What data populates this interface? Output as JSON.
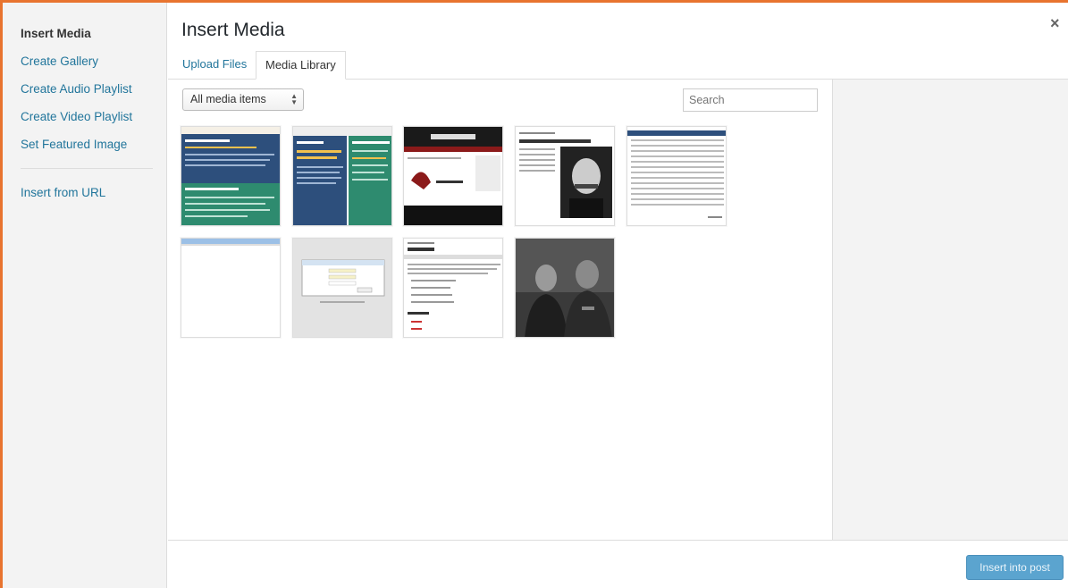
{
  "sidebar": {
    "items": [
      {
        "label": "Insert Media",
        "active": true
      },
      {
        "label": "Create Gallery"
      },
      {
        "label": "Create Audio Playlist"
      },
      {
        "label": "Create Video Playlist"
      },
      {
        "label": "Set Featured Image"
      }
    ],
    "url_item": "Insert from URL"
  },
  "modal": {
    "title": "Insert Media",
    "close_icon": "×"
  },
  "tabs": [
    {
      "label": "Upload Files"
    },
    {
      "label": "Media Library",
      "active": true
    }
  ],
  "toolbar": {
    "filter_value": "All media items",
    "search_placeholder": "Search"
  },
  "thumbnails": [
    {
      "name": "blog-post-screenshot-1",
      "icon": "image-icon"
    },
    {
      "name": "blog-post-screenshot-2",
      "icon": "image-icon"
    },
    {
      "name": "website-screenshot-red",
      "icon": "image-icon"
    },
    {
      "name": "nietzsche-article",
      "icon": "image-icon"
    },
    {
      "name": "spreadsheet-table",
      "icon": "image-icon"
    },
    {
      "name": "blank-page",
      "icon": "image-icon"
    },
    {
      "name": "login-dialog",
      "icon": "image-icon"
    },
    {
      "name": "document-page",
      "icon": "image-icon"
    },
    {
      "name": "photo-two-men",
      "icon": "image-icon"
    }
  ],
  "footer": {
    "insert_button": "Insert into post"
  },
  "colors": {
    "accent_border": "#e8742f",
    "link": "#21759b",
    "primary_button": "#5ba4cf"
  }
}
